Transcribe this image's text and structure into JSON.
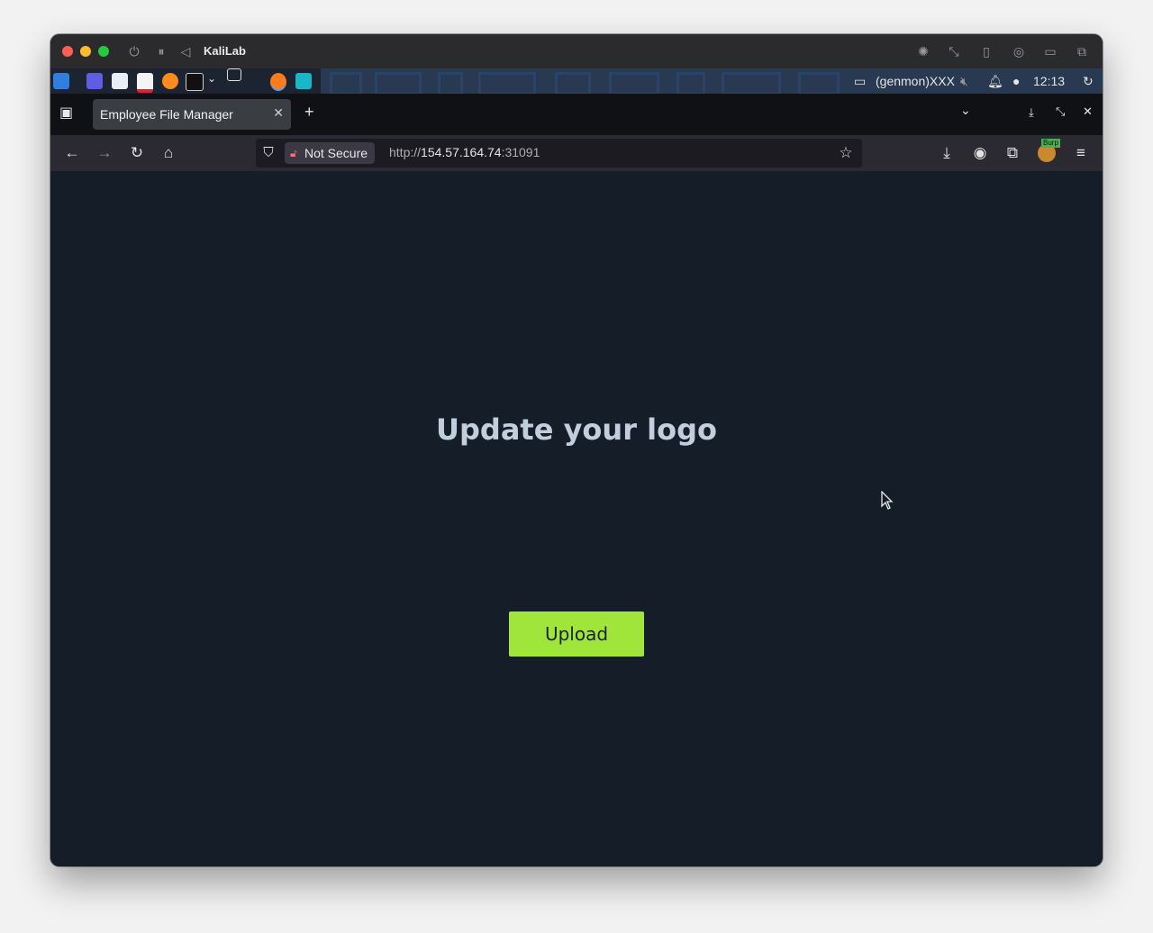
{
  "vm_window": {
    "title": "KaliLab"
  },
  "panel": {
    "genmon": "(genmon)XXX",
    "clock": "12:13"
  },
  "browser": {
    "tab_title": "Employee File Manager",
    "security_label": "Not Secure",
    "url_scheme": "http://",
    "url_host": "154.57.164.74",
    "url_port": ":31091",
    "extension_badge": "Burp"
  },
  "page": {
    "heading": "Update your logo",
    "upload_label": "Upload"
  },
  "colors": {
    "page_bg": "#151d29",
    "button_bg": "#a0e63a",
    "heading": "#c3cedd"
  }
}
